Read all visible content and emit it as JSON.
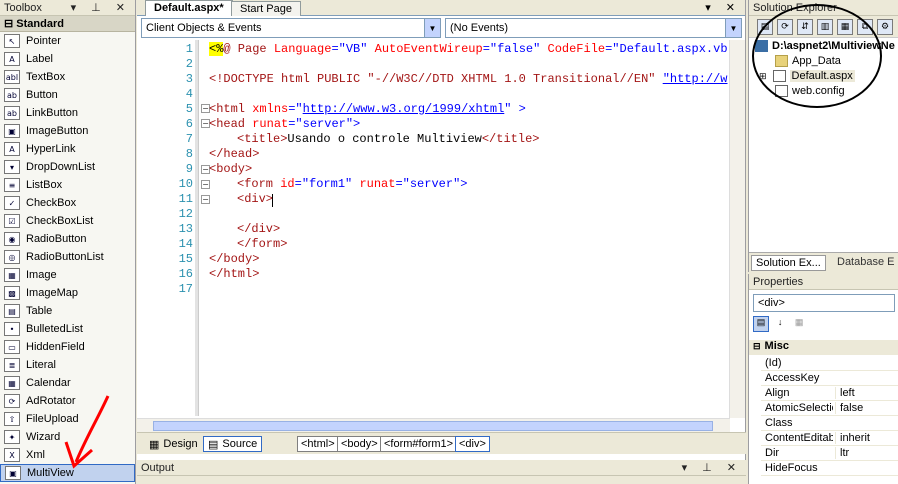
{
  "toolbox": {
    "title": "Toolbox",
    "section": "Standard",
    "items": [
      {
        "label": "Pointer",
        "icon": "pointer-icon",
        "glyph": "↖"
      },
      {
        "label": "Label",
        "icon": "label-icon",
        "glyph": "A"
      },
      {
        "label": "TextBox",
        "icon": "textbox-icon",
        "glyph": "abl"
      },
      {
        "label": "Button",
        "icon": "button-icon",
        "glyph": "ab"
      },
      {
        "label": "LinkButton",
        "icon": "linkbutton-icon",
        "glyph": "ab"
      },
      {
        "label": "ImageButton",
        "icon": "imagebutton-icon",
        "glyph": "▣"
      },
      {
        "label": "HyperLink",
        "icon": "hyperlink-icon",
        "glyph": "A"
      },
      {
        "label": "DropDownList",
        "icon": "dropdownlist-icon",
        "glyph": "▾"
      },
      {
        "label": "ListBox",
        "icon": "listbox-icon",
        "glyph": "≡"
      },
      {
        "label": "CheckBox",
        "icon": "checkbox-icon",
        "glyph": "✓"
      },
      {
        "label": "CheckBoxList",
        "icon": "checkboxlist-icon",
        "glyph": "☑"
      },
      {
        "label": "RadioButton",
        "icon": "radiobutton-icon",
        "glyph": "◉"
      },
      {
        "label": "RadioButtonList",
        "icon": "radiobuttonlist-icon",
        "glyph": "◎"
      },
      {
        "label": "Image",
        "icon": "image-icon",
        "glyph": "▦"
      },
      {
        "label": "ImageMap",
        "icon": "imagemap-icon",
        "glyph": "▩"
      },
      {
        "label": "Table",
        "icon": "table-icon",
        "glyph": "▤"
      },
      {
        "label": "BulletedList",
        "icon": "bulletedlist-icon",
        "glyph": "•"
      },
      {
        "label": "HiddenField",
        "icon": "hiddenfield-icon",
        "glyph": "▭"
      },
      {
        "label": "Literal",
        "icon": "literal-icon",
        "glyph": "≣"
      },
      {
        "label": "Calendar",
        "icon": "calendar-icon",
        "glyph": "▦"
      },
      {
        "label": "AdRotator",
        "icon": "adrotator-icon",
        "glyph": "⟳"
      },
      {
        "label": "FileUpload",
        "icon": "fileupload-icon",
        "glyph": "⇧"
      },
      {
        "label": "Wizard",
        "icon": "wizard-icon",
        "glyph": "✦"
      },
      {
        "label": "Xml",
        "icon": "xml-icon",
        "glyph": "X"
      },
      {
        "label": "MultiView",
        "icon": "multiview-icon",
        "glyph": "▣"
      }
    ]
  },
  "editor": {
    "tabs": [
      "Default.aspx*",
      "Start Page"
    ],
    "object_combo": "Client Objects & Events",
    "event_combo": "(No Events)",
    "views": [
      "Design",
      "Source"
    ],
    "breadcrumbs": [
      "<html>",
      "<body>",
      "<form#form1>",
      "<div>"
    ]
  },
  "code_lines": [
    {
      "n": "1"
    },
    {
      "n": "2"
    },
    {
      "n": "3"
    },
    {
      "n": "4"
    },
    {
      "n": "5"
    },
    {
      "n": "6"
    },
    {
      "n": "7"
    },
    {
      "n": "8"
    },
    {
      "n": "9"
    },
    {
      "n": "10"
    },
    {
      "n": "11"
    },
    {
      "n": "12"
    },
    {
      "n": "13"
    },
    {
      "n": "14"
    },
    {
      "n": "15"
    },
    {
      "n": "16"
    },
    {
      "n": "17"
    }
  ],
  "code_text": {
    "l1a": "<%",
    "l1b": "@ Page ",
    "l1c": "Language",
    "l1d": "=\"VB\" ",
    "l1e": "AutoEventWireup",
    "l1f": "=\"false\" ",
    "l1g": "CodeFile",
    "l1h": "=\"Default.aspx.vb",
    "l3a": "<!DOCTYPE html PUBLIC \"-//W3C//DTD XHTML 1.0 Transitional//EN\" ",
    "l3b": "\"http://w",
    "l5a": "<html ",
    "l5b": "xmlns",
    "l5c": "=\"",
    "l5d": "http://www.w3.org/1999/xhtml",
    "l5e": "\" >",
    "l6a": "<head ",
    "l6b": "runat",
    "l6c": "=\"server\">",
    "l7a": "<title>",
    "l7b": "Usando o controle Multiview",
    "l7c": "</title>",
    "l8": "</head>",
    "l9": "<body>",
    "l10a": "<form ",
    "l10b": "id",
    "l10c": "=\"form1\" ",
    "l10d": "runat",
    "l10e": "=\"server\">",
    "l11": "<div>",
    "l13": "</div>",
    "l14": "</form>",
    "l15": "</body>",
    "l16": "</html>"
  },
  "output": {
    "title": "Output"
  },
  "solution_explorer": {
    "title": "Solution Explorer",
    "root": "D:\\aspnet2\\MultiviewNe",
    "items": [
      "App_Data",
      "Default.aspx",
      "web.config"
    ],
    "bottom_tabs": [
      "Solution Ex...",
      "Database E"
    ]
  },
  "properties": {
    "title": "Properties",
    "object": "<div>",
    "category": "Misc",
    "rows": [
      {
        "name": "(Id)",
        "value": ""
      },
      {
        "name": "AccessKey",
        "value": ""
      },
      {
        "name": "Align",
        "value": "left"
      },
      {
        "name": "AtomicSelection",
        "value": "false"
      },
      {
        "name": "Class",
        "value": ""
      },
      {
        "name": "ContentEditable",
        "value": "inherit"
      },
      {
        "name": "Dir",
        "value": "ltr"
      },
      {
        "name": "HideFocus",
        "value": ""
      }
    ]
  },
  "colors": {
    "annotation": "#ff0000",
    "selection": "#c1d2ee",
    "line_number": "#2b91af"
  }
}
